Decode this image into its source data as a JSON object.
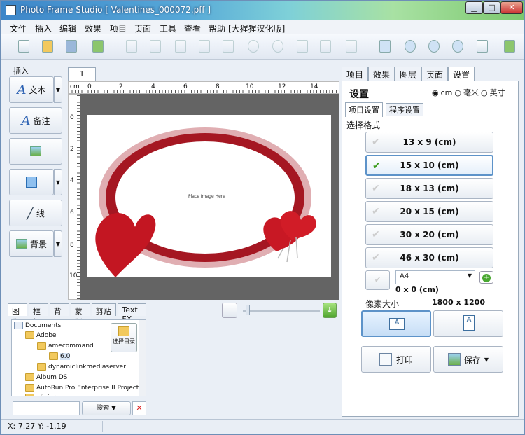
{
  "window": {
    "title": "Photo Frame Studio [ Valentines_000072.pff ]",
    "buttons": {
      "minimize": "▁",
      "maximize": "□",
      "close": "✕"
    }
  },
  "menu": [
    "文件",
    "插入",
    "编辑",
    "效果",
    "项目",
    "页面",
    "工具",
    "查看",
    "帮助",
    "[大猩猩汉化版]"
  ],
  "insert_panel": {
    "title": "插入",
    "text_label": "文本",
    "note_label": "备注",
    "line_label": "线",
    "background_label": "背景"
  },
  "canvas": {
    "page_tab": "1",
    "unit": "cm",
    "ruler_h": [
      "0",
      "2",
      "4",
      "6",
      "8",
      "10",
      "12",
      "14"
    ],
    "ruler_v": [
      "0",
      "2",
      "4",
      "6",
      "8",
      "10"
    ],
    "placeholder": "Place Image Here"
  },
  "browser": {
    "tabs": [
      "图像",
      "框架",
      "背景",
      "蒙版",
      "剪贴画",
      "Text FX"
    ],
    "tree": [
      "Documents",
      "Adobe",
      "amecommand",
      "6.0",
      "dynamiclinkmediaserver",
      "Album DS",
      "AutoRun Pro Enterprise II Projects",
      "olivier"
    ],
    "pick_label": "选择目录",
    "search_label": "搜索"
  },
  "right_panel": {
    "tabs": [
      "项目",
      "效果",
      "图层",
      "页面",
      "设置"
    ],
    "title": "设置",
    "units": [
      "cm",
      "毫米",
      "英寸"
    ],
    "subtabs": [
      "项目设置",
      "程序设置"
    ],
    "format_label": "选择格式",
    "sizes": [
      "13 x 9 (cm)",
      "15 x 10 (cm)",
      "18 x 13 (cm)",
      "20 x 15 (cm)",
      "30 x 20 (cm)",
      "46 x 30 (cm)"
    ],
    "selected_size": "15 x 10 (cm)",
    "paper": "A4",
    "paper_size": "0 x 0 (cm)",
    "pixel_label": "像素大小",
    "pixel_value": "1800 x 1200",
    "print_label": "打印",
    "save_label": "保存"
  },
  "status": {
    "coords": "X: 7.27 Y: -1.19"
  }
}
